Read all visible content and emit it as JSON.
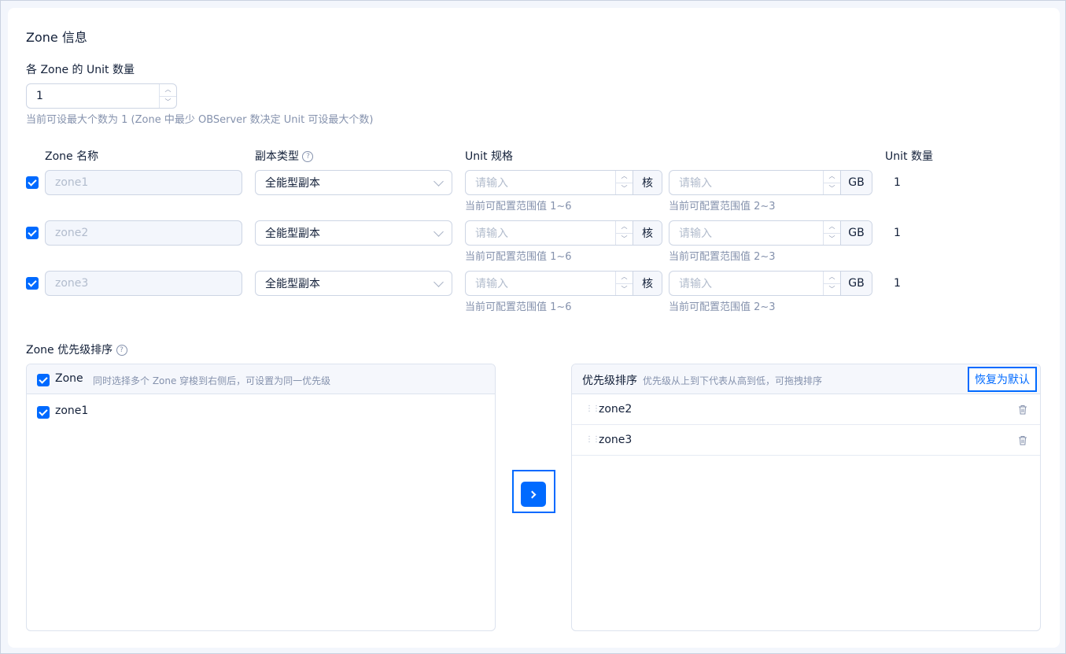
{
  "section_title": "Zone 信息",
  "unit_count": {
    "label": "各 Zone 的 Unit 数量",
    "value": "1",
    "hint": "当前可设最大个数为 1 (Zone 中最少 OBServer 数决定 Unit 可设最大个数)"
  },
  "table": {
    "headers": {
      "zone_name": "Zone 名称",
      "replica_type": "副本类型",
      "unit_spec": "Unit 规格",
      "unit_count": "Unit 数量"
    },
    "rows": [
      {
        "zone": "zone1",
        "replica": "全能型副本",
        "cpu_placeholder": "请输入",
        "cpu_unit": "核",
        "cpu_hint": "当前可配置范围值 1~6",
        "mem_placeholder": "请输入",
        "mem_unit": "GB",
        "mem_hint": "当前可配置范围值 2~3",
        "count": "1"
      },
      {
        "zone": "zone2",
        "replica": "全能型副本",
        "cpu_placeholder": "请输入",
        "cpu_unit": "核",
        "cpu_hint": "当前可配置范围值 1~6",
        "mem_placeholder": "请输入",
        "mem_unit": "GB",
        "mem_hint": "当前可配置范围值 2~3",
        "count": "1"
      },
      {
        "zone": "zone3",
        "replica": "全能型副本",
        "cpu_placeholder": "请输入",
        "cpu_unit": "核",
        "cpu_hint": "当前可配置范围值 1~6",
        "mem_placeholder": "请输入",
        "mem_unit": "GB",
        "mem_hint": "当前可配置范围值 2~3",
        "count": "1"
      }
    ]
  },
  "priority": {
    "label": "Zone 优先级排序",
    "left_panel": {
      "header_label": "Zone",
      "header_hint": "同时选择多个 Zone 穿梭到右侧后，可设置为同一优先级",
      "items": [
        "zone1"
      ]
    },
    "right_panel": {
      "header_label": "优先级排序",
      "header_hint": "优先级从上到下代表从高到低，可拖拽排序",
      "reset_label": "恢复为默认",
      "items": [
        "zone2",
        "zone3"
      ]
    }
  },
  "colors": {
    "primary": "#006aff",
    "hint_text": "#8592ad",
    "border": "#cdd5e4"
  }
}
